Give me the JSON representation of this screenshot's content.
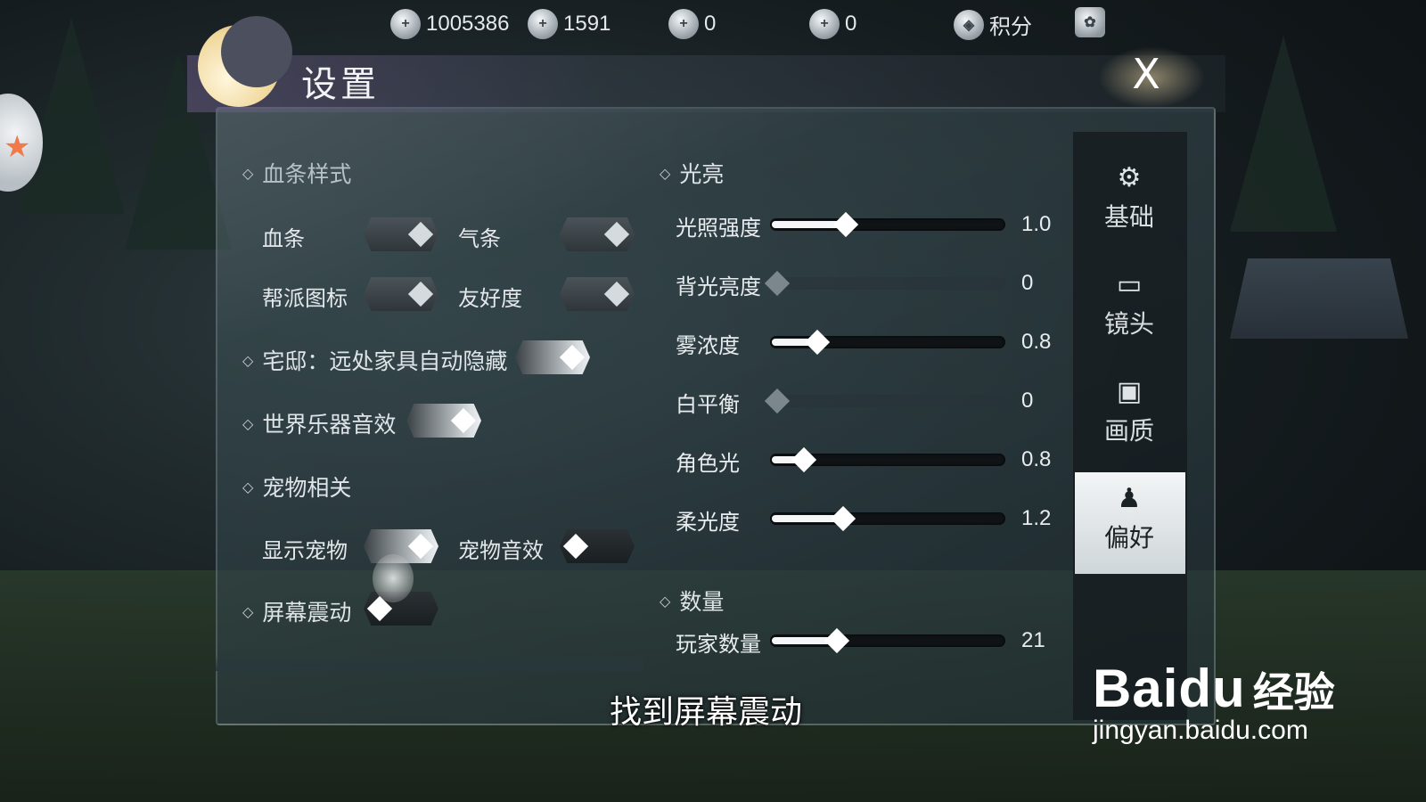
{
  "topbar": {
    "currency1": "1005386",
    "currency2": "1591",
    "currency3": "0",
    "currency4": "0",
    "points_label": "积分"
  },
  "window": {
    "title": "设置",
    "close_label": "X"
  },
  "left": {
    "hp_style": "血条样式",
    "hp_bar": "血条",
    "qi_bar": "气条",
    "guild_icon": "帮派图标",
    "friendship": "友好度",
    "housing": "宅邸：远处家具自动隐藏",
    "world_music": "世界乐器音效",
    "pet_section": "宠物相关",
    "show_pet": "显示宠物",
    "pet_sound": "宠物音效",
    "screen_shake": "屏幕震动"
  },
  "right": {
    "lighting": "光亮",
    "quantity": "数量",
    "sliders": [
      {
        "label": "光照强度",
        "value": "1.0",
        "fraction": 0.31
      },
      {
        "label": "背光亮度",
        "value": "0",
        "fraction": 0.0
      },
      {
        "label": "雾浓度",
        "value": "0.8",
        "fraction": 0.18
      },
      {
        "label": "白平衡",
        "value": "0",
        "fraction": 0.0
      },
      {
        "label": "角色光",
        "value": "0.8",
        "fraction": 0.12
      },
      {
        "label": "柔光度",
        "value": "1.2",
        "fraction": 0.3
      },
      {
        "label": "玩家数量",
        "value": "21",
        "fraction": 0.27
      }
    ]
  },
  "sidebar": {
    "tabs": [
      {
        "label": "基础",
        "icon": "gear-icon"
      },
      {
        "label": "镜头",
        "icon": "camera-icon"
      },
      {
        "label": "画质",
        "icon": "monitor-icon"
      },
      {
        "label": "偏好",
        "icon": "user-settings-icon"
      }
    ]
  },
  "caption": "找到屏幕震动",
  "watermark": {
    "brand": "Bai",
    "brand_mark": "du",
    "brand2": "经验",
    "url": "jingyan.baidu.com"
  }
}
